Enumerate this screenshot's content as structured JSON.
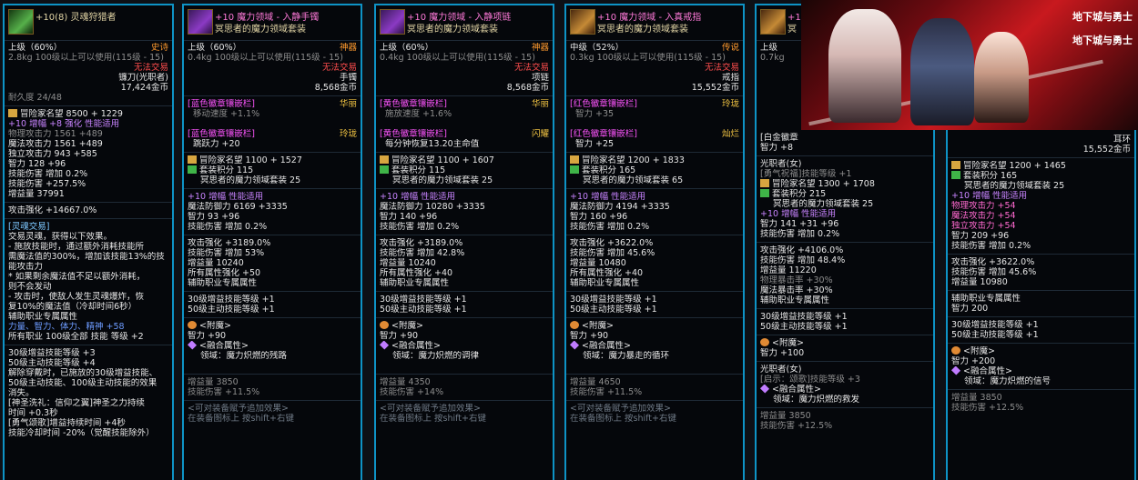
{
  "card1": {
    "enhance": "+10(8)",
    "name": "灵魂狩猎者",
    "grade": "上级（60%）",
    "rarity": "史诗",
    "weight": "2.8kg",
    "level": "100级以上可以使用(115级 - 15)",
    "trade": "无法交易",
    "type": "镰刀(光职者)",
    "price": "17,424金币",
    "durability": "耐久度 24/48",
    "fame": "冒险家名望 8500 + 1229",
    "amp": "+10 增幅 +8 强化 性能适用",
    "stats": [
      "物理攻击力 1561 +489",
      "魔法攻击力 1561 +489",
      "独立攻击力 943 +585",
      "智力 128 +96",
      "技能伤害 增加 0.2%",
      "技能伤害 +257.5%",
      "增益量 37991"
    ],
    "attack_boost": "攻击强化 +14667.0%",
    "trade_label": "[灵魂交易]",
    "effects": [
      "交易灵魂，获得以下效果。",
      "- 施放技能时，通过额外消耗技能所",
      "需魔法值的300%，增加该技能13%的技",
      "能攻击力",
      " * 如果剩余魔法值不足以额外消耗，",
      "则不会发动",
      "- 攻击时，使敌人发生灵魂爆炸，恢",
      "复10%的魔法值（冷却时间6秒）"
    ],
    "support_title": "辅助职业专属属性",
    "support_stats": "力量、智力、体力、精神 +58",
    "support_skill": "所有职业 100级全部 技能 等级 +2",
    "skills": [
      "30级增益技能等级 +3",
      "50级主动技能等级 +4",
      "解除穿戴时，已施放的30级增益技能、",
      "50级主动技能、100级主动技能的效果",
      "消失。",
      "[神圣洗礼：信仰之翼]神圣之力持续",
      "时间 +0.3秒",
      "[勇气颂歌]增益持续时间 +4秒",
      "技能冷却时间 -20%（觉醒技能除外）"
    ]
  },
  "card2": {
    "name": "+10 魔力领域 - 入静手镯",
    "set": "冥思者的魔力领域套装",
    "grade": "上级（60%）",
    "rarity": "神器",
    "weight": "0.4kg",
    "level": "100级以上可以使用(115级 - 15)",
    "trade": "无法交易",
    "type": "手镯",
    "price": "8,568金币",
    "slot1_title": "[蓝色徽章镶嵌栏]",
    "slot1_grade": "华丽",
    "slot1_stat": "移动速度 +1.1%",
    "slot2_title": "[蓝色徽章镶嵌栏]",
    "slot2_grade": "玲珑",
    "slot2_stat": "跳跃力 +20",
    "fame": "冒险家名望 1100 + 1527",
    "setpoint": "套装积分 115",
    "setname": "冥思者的魔力领域套装 25",
    "amp": "+10 增幅 性能适用",
    "stats": [
      "魔法防御力 6169 +3335",
      "智力 93 +96",
      "技能伤害 增加 0.2%"
    ],
    "stats2": [
      "攻击强化 +3189.0%",
      "技能伤害 增加 53%",
      "增益量 10240",
      "所有属性强化 +50"
    ],
    "support_title": "辅助职业专属属性",
    "skills": [
      "30级增益技能等级 +1",
      "50级主动技能等级 +1"
    ],
    "enchant_title": "<附魔>",
    "enchant": "智力 +90",
    "fusion_title": "<融合属性>",
    "fusion": "领域：魔力炽燃的残路",
    "buff": "增益量 3850",
    "skilldmg": "技能伤害 +11.5%",
    "addeff": "<可对装备赋予追加效果>",
    "addhint": "在装备图标上 按shift+右键"
  },
  "card3": {
    "name": "+10 魔力领域 - 入静项链",
    "set": "冥思者的魔力领域套装",
    "grade": "上级（60%）",
    "rarity": "神器",
    "weight": "0.4kg",
    "level": "100级以上可以使用(115级 - 15)",
    "trade": "无法交易",
    "type": "项链",
    "price": "8,568金币",
    "slot1_title": "[黄色徽章镶嵌栏]",
    "slot1_grade": "华丽",
    "slot1_stat": "施放速度 +1.6%",
    "slot2_title": "[黄色徽章镶嵌栏]",
    "slot2_grade": "闪耀",
    "slot2_stat": "每分钟恢复13.20主命值",
    "fame": "冒险家名望 1100 + 1607",
    "setpoint": "套装积分 115",
    "setname": "冥思者的魔力领域套装 25",
    "amp": "+10 增幅 性能适用",
    "stats": [
      "魔法防御力 10280 +3335",
      "智力 140 +96",
      "技能伤害 增加 0.2%"
    ],
    "stats2": [
      "攻击强化 +3189.0%",
      "技能伤害 增加 42.8%",
      "增益量 10240",
      "所有属性强化 +40"
    ],
    "support_title": "辅助职业专属属性",
    "skills": [
      "30级增益技能等级 +1",
      "50级主动技能等级 +1"
    ],
    "enchant_title": "<附魔>",
    "enchant": "智力 +90",
    "fusion_title": "<融合属性>",
    "fusion": "领域：魔力炽燃的调律",
    "buff": "增益量 4350",
    "skilldmg": "技能伤害 +14%",
    "addeff": "<可对装备赋予追加效果>",
    "addhint": "在装备图标上 按shift+右键"
  },
  "card4": {
    "name": "+10 魔力领域 - 入真戒指",
    "set": "冥思者的魔力领域套装",
    "grade": "中级（52%）",
    "rarity": "传说",
    "weight": "0.3kg",
    "level": "100级以上可以使用(115级 - 15)",
    "trade": "无法交易",
    "type": "戒指",
    "price": "15,552金币",
    "slot1_title": "[红色徽章镶嵌栏]",
    "slot1_grade": "玲珑",
    "slot1_stat": "智力 +35",
    "slot2_title": "[红色徽章镶嵌栏]",
    "slot2_grade": "灿烂",
    "slot2_stat": "智力 +25",
    "fame": "冒险家名望 1200 + 1833",
    "setpoint": "套装积分 165",
    "setname": "冥思者的魔力领域套装 65",
    "amp": "+10 增幅 性能适用",
    "stats": [
      "魔法防御力 4194 +3335",
      "智力 160 +96",
      "技能伤害 增加 0.2%"
    ],
    "stats2": [
      "攻击强化 +3622.0%",
      "技能伤害 增加 45.6%",
      "增益量 10480",
      "所有属性强化 +40"
    ],
    "support_title": "辅助职业专属属性",
    "skills": [
      "30级增益技能等级 +1",
      "50级主动技能等级 +1"
    ],
    "enchant_title": "<附魔>",
    "enchant": "智力 +90",
    "fusion_title": "<融合属性>",
    "fusion": "领域：魔力暴走的循环",
    "buff": "增益量 4650",
    "skilldmg": "技能伤害 +11.5%",
    "addeff": "<可对装备赋予追加效果>",
    "addhint": "在装备图标上 按shift+右键"
  },
  "card5": {
    "name": "+10",
    "set": "冥",
    "grade": "上级",
    "weight": "0.7kg",
    "slot1_title": "[白金徽章",
    "slot1_stat": "智力 +8",
    "job": "光职者(女)",
    "job_skill": "[勇气祝福]技能等级 +1",
    "fame": "冒险家名望 1300 + 1708",
    "setpoint": "套装积分 215",
    "setname": "冥思者的魔力领域套装 25",
    "amp": "+10 增幅 性能适用",
    "stats": [
      "智力 141 +31 +96",
      "技能伤害 增加 0.2%"
    ],
    "stats2": [
      "攻击强化 +4106.0%",
      "技能伤害 增加 48.4%",
      "增益量 11220",
      "物理暴击率 +30%",
      "魔法暴击率 +30%"
    ],
    "support_title": "辅助职业专属属性",
    "skills": [
      "30级增益技能等级 +1",
      "50级主动技能等级 +1"
    ],
    "enchant_title": "<附魔>",
    "enchant": "智力 +100",
    "job2": "光职者(女)",
    "job2_skill": "[启示：颂歌]技能等级 +3",
    "fusion_title": "<融合属性>",
    "fusion": "领域：魔力炽燃的救发",
    "buff": "增益量 3850",
    "skilldmg": "技能伤害 +12.5%"
  },
  "card6": {
    "type": "耳环",
    "price": "15,552金币",
    "fame": "冒险家名望 1200 + 1465",
    "setpoint": "套装积分 165",
    "setname": "冥思者的魔力领域套装 25",
    "amp": "+10 增幅 性能适用",
    "stats": [
      "物理攻击力 +54",
      "魔法攻击力 +54",
      "独立攻击力 +54",
      "智力 209 +96",
      "技能伤害 增加 0.2%"
    ],
    "stats2": [
      "攻击强化 +3622.0%",
      "技能伤害 增加 45.6%",
      "增益量 10980"
    ],
    "support_title": "辅助职业专属属性",
    "support_stat": "智力 200",
    "skills": [
      "30级增益技能等级 +1",
      "50级主动技能等级 +1"
    ],
    "enchant_title": "<附魔>",
    "enchant": "智力 +200",
    "fusion_title": "<融合属性>",
    "fusion": "领域：魔力炽燃的信号",
    "buff": "增益量 3850",
    "skilldmg": "技能伤害 +12.5%"
  },
  "banner": {
    "logo1": "地下城与勇士",
    "logo2": "地下城与勇士"
  }
}
